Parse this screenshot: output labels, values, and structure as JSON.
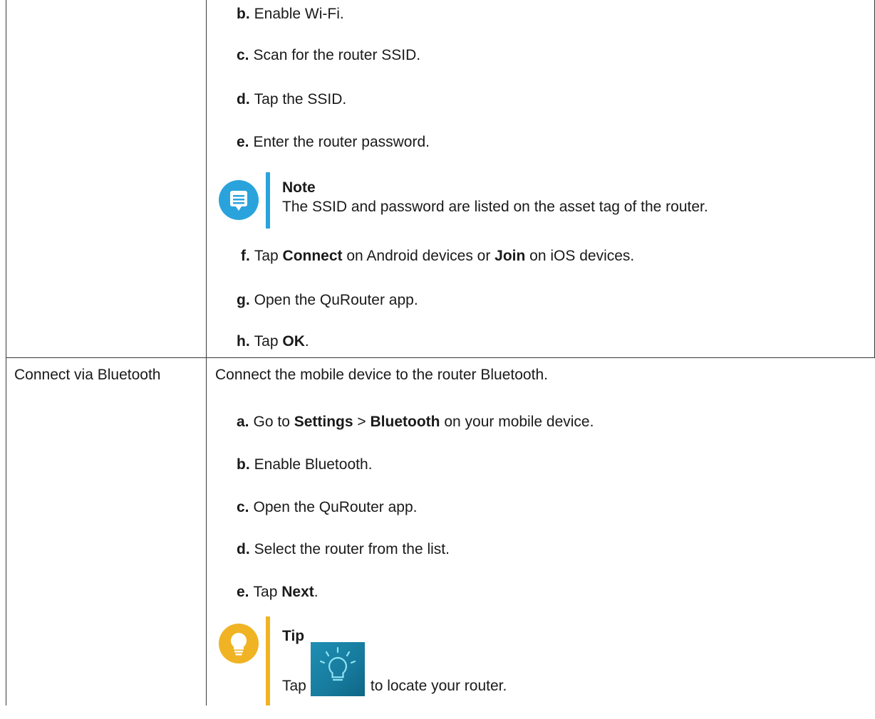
{
  "top_section": {
    "steps": [
      {
        "letter": "b.",
        "parts": [
          {
            "t": "Enable Wi-Fi.",
            "b": false
          }
        ]
      },
      {
        "letter": "c.",
        "parts": [
          {
            "t": "Scan for the router SSID.",
            "b": false
          }
        ]
      },
      {
        "letter": "d.",
        "parts": [
          {
            "t": "Tap the SSID.",
            "b": false
          }
        ]
      },
      {
        "letter": "e.",
        "parts": [
          {
            "t": "Enter the router password.",
            "b": false
          }
        ]
      }
    ],
    "note": {
      "title": "Note",
      "body": "The SSID and password are listed on the asset tag of the router.",
      "icon": "note-icon",
      "color": "#2aa3dc"
    },
    "steps_after": [
      {
        "letter": "f.",
        "parts": [
          {
            "t": "Tap ",
            "b": false
          },
          {
            "t": "Connect",
            "b": true
          },
          {
            "t": " on Android devices or ",
            "b": false
          },
          {
            "t": "Join",
            "b": true
          },
          {
            "t": " on iOS devices.",
            "b": false
          }
        ]
      },
      {
        "letter": "g.",
        "parts": [
          {
            "t": "Open the QuRouter app.",
            "b": false
          }
        ]
      },
      {
        "letter": "h.",
        "parts": [
          {
            "t": "Tap ",
            "b": false
          },
          {
            "t": "OK",
            "b": true
          },
          {
            "t": ".",
            "b": false
          }
        ]
      }
    ]
  },
  "bluetooth_section": {
    "label": "Connect via Bluetooth",
    "intro": "Connect the mobile device to the router Bluetooth.",
    "steps": [
      {
        "letter": "a.",
        "parts": [
          {
            "t": "Go to ",
            "b": false
          },
          {
            "t": "Settings",
            "b": true
          },
          {
            "t": " > ",
            "b": false
          },
          {
            "t": "Bluetooth",
            "b": true
          },
          {
            "t": " on your mobile device.",
            "b": false
          }
        ]
      },
      {
        "letter": "b.",
        "parts": [
          {
            "t": "Enable Bluetooth.",
            "b": false
          }
        ]
      },
      {
        "letter": "c.",
        "parts": [
          {
            "t": "Open the QuRouter app.",
            "b": false
          }
        ]
      },
      {
        "letter": "d.",
        "parts": [
          {
            "t": "Select the router from the list.",
            "b": false
          }
        ]
      },
      {
        "letter": "e.",
        "parts": [
          {
            "t": "Tap ",
            "b": false
          },
          {
            "t": "Next",
            "b": true
          },
          {
            "t": ".",
            "b": false
          }
        ]
      }
    ],
    "tip": {
      "title": "Tip",
      "body_before": "Tap",
      "body_after": "to locate your router.",
      "icon": "lightbulb-icon",
      "inline_icon": "locate-router-icon",
      "color": "#f0b323"
    }
  }
}
